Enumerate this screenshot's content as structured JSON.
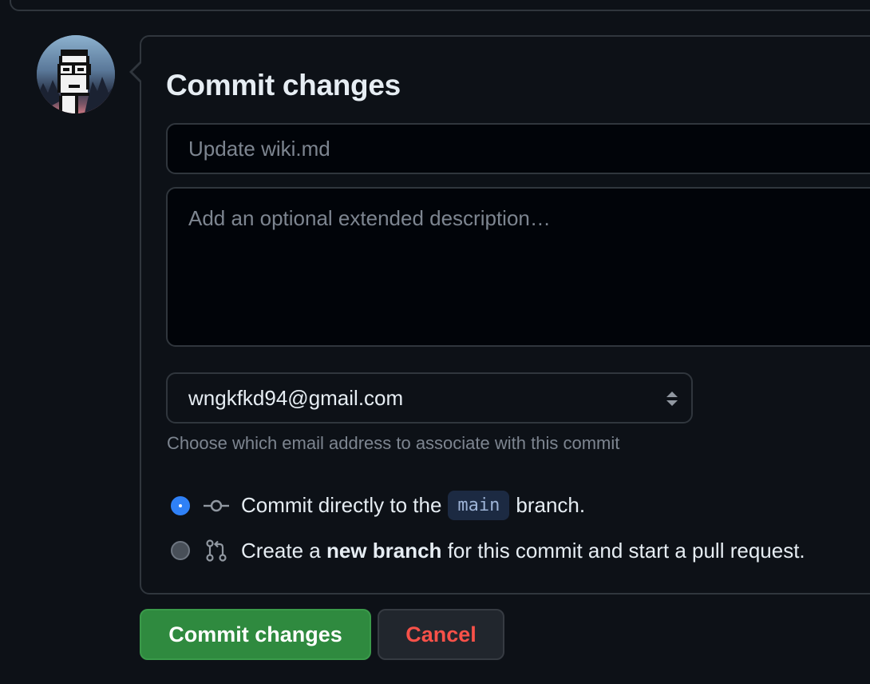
{
  "form": {
    "title": "Commit changes",
    "summary_placeholder": "Update wiki.md",
    "description_placeholder": "Add an optional extended description…",
    "email_selected": "wngkfkd94@gmail.com",
    "email_hint": "Choose which email address to associate with this commit",
    "options": {
      "direct_prefix": "Commit directly to the",
      "direct_branch": "main",
      "direct_suffix": "branch.",
      "new_prefix": "Create a",
      "new_bold": "new branch",
      "new_suffix": "for this commit and start a pull request."
    },
    "selected_option": "direct"
  },
  "buttons": {
    "commit_label": "Commit changes",
    "cancel_label": "Cancel"
  },
  "icons": {
    "avatar": "pixel-avatar",
    "commit_icon": "git-commit-icon",
    "pull_request_icon": "git-pull-request-icon",
    "select_arrows": "select-arrows-icon"
  },
  "colors": {
    "background": "#0d1117",
    "primary_button": "#2f8a3f",
    "danger_text": "#f85149",
    "radio_selected": "#2f81f7"
  }
}
